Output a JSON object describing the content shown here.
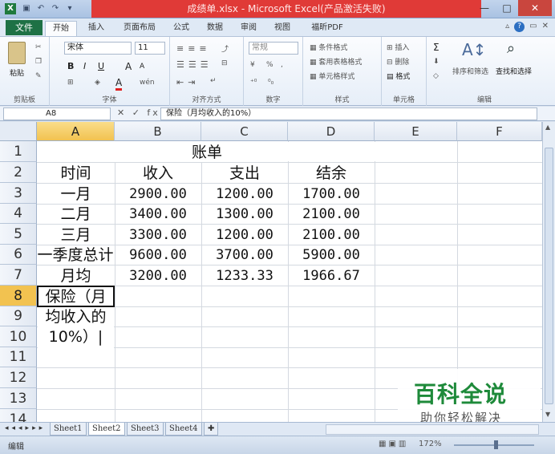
{
  "window": {
    "title": "成绩单.xlsx - Microsoft Excel(产品激活失败)",
    "app_icon": "X",
    "minimize_glyph": "—",
    "maximize_glyph": "□",
    "close_glyph": "✕"
  },
  "ribbon_tabs": [
    "文件",
    "开始",
    "插入",
    "页面布局",
    "公式",
    "数据",
    "审阅",
    "视图",
    "福昕PDF"
  ],
  "ribbon": {
    "clipboard": {
      "label": "剪贴板",
      "paste": "粘贴"
    },
    "font": {
      "label": "字体",
      "font_name": "宋体",
      "font_size": "11",
      "bold": "B",
      "italic": "I",
      "underline": "U",
      "grow": "A",
      "shrink": "A",
      "color_a": "A",
      "phonetic": "wén"
    },
    "alignment": {
      "label": "对齐方式"
    },
    "number": {
      "label": "数字",
      "format": "常规",
      "percent": "%",
      "comma": ","
    },
    "styles": {
      "label": "样式",
      "conditional": "条件格式",
      "table_format": "套用表格格式",
      "cell_styles": "单元格样式"
    },
    "cells": {
      "label": "单元格",
      "insert": "插入",
      "delete": "删除",
      "format": "格式"
    },
    "editing": {
      "label": "编辑",
      "sum": "Σ",
      "sort": "排序和筛选",
      "find": "查找和选择"
    }
  },
  "formula_bar": {
    "name_box": "A8",
    "fx_symbols": "✕ ✓ fx",
    "content": "保险（月均收入的10%）"
  },
  "columns": [
    "A",
    "B",
    "C",
    "D",
    "E",
    "F"
  ],
  "rows": [
    "1",
    "2",
    "3",
    "4",
    "5",
    "6",
    "7",
    "8",
    "9",
    "10",
    "11",
    "12",
    "13",
    "14"
  ],
  "sheet": {
    "title": "账单",
    "headers": [
      "时间",
      "收入",
      "支出",
      "结余"
    ],
    "data": [
      [
        "一月",
        "2900.00",
        "1200.00",
        "1700.00"
      ],
      [
        "二月",
        "3400.00",
        "1300.00",
        "2100.00"
      ],
      [
        "三月",
        "3300.00",
        "1200.00",
        "2100.00"
      ],
      [
        "第一季度总计",
        "9600.00",
        "3700.00",
        "5900.00"
      ],
      [
        "月均",
        "3200.00",
        "1233.33",
        "1966.67"
      ]
    ],
    "editing_cell_lines": [
      "保险（月",
      "均收入的",
      "10%）"
    ]
  },
  "sheet_tabs": [
    "Sheet1",
    "Sheet2",
    "Sheet3",
    "Sheet4"
  ],
  "active_sheet": "Sheet2",
  "status": {
    "mode": "编辑",
    "zoom": "172%"
  },
  "watermark": {
    "title": "百科全说",
    "subtitle": "助你轻松解决"
  }
}
